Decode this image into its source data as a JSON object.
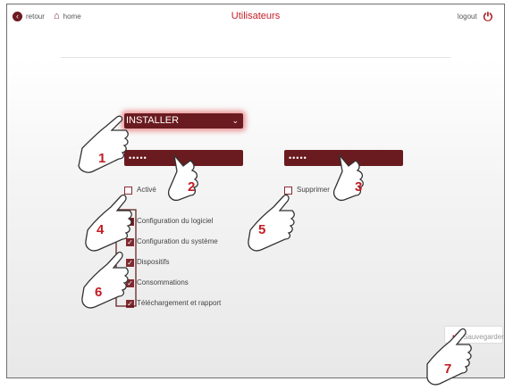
{
  "header": {
    "back_label": "retour",
    "home_label": "home",
    "title": "Utilisateurs",
    "logout_label": "logout"
  },
  "form": {
    "role_select": {
      "selected": "INSTALLER"
    },
    "password": "•••••",
    "password_confirm": "•••••",
    "active_label": "Activé",
    "delete_label": "Supprimer",
    "permissions": [
      {
        "label": "Configuration du logiciel",
        "checked": false
      },
      {
        "label": "Configuration du système",
        "checked": true
      },
      {
        "label": "Dispositifs",
        "checked": true
      },
      {
        "label": "Consommations",
        "checked": true
      },
      {
        "label": "Téléchargement et rapport",
        "checked": true
      }
    ],
    "save_label": "Sauvegarder"
  },
  "annotations": [
    "1",
    "2",
    "3",
    "4",
    "5",
    "6",
    "7"
  ],
  "colors": {
    "accent": "#6a1b1f",
    "title": "#c9202a",
    "callout": "#c21c24"
  }
}
